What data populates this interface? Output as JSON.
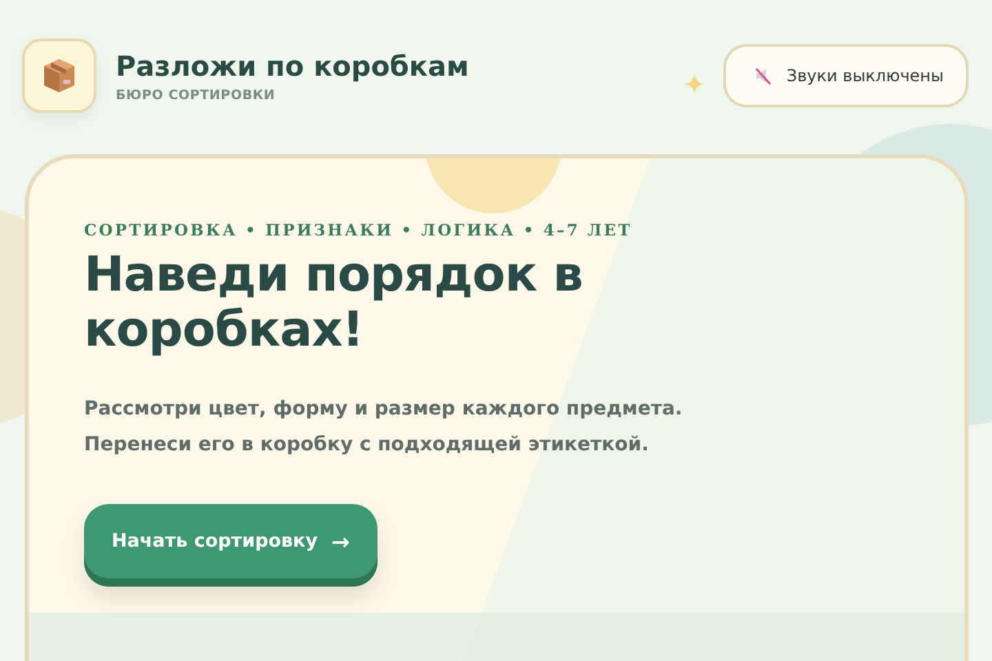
{
  "header": {
    "title": "Разложи по коробкам",
    "subtitle": "БЮРО СОРТИРОВКИ"
  },
  "sound": {
    "label": "Звуки выключены",
    "muted": true
  },
  "hero": {
    "eyebrow": "СОРТИРОВКА • ПРИЗНАКИ • ЛОГИКА • 4–7 ЛЕТ",
    "heading": "Наведи порядок в коробках!",
    "lines": [
      "Рассмотри цвет, форму и размер каждого предмета.",
      "Перенеси его в коробку с подходящей этикеткой."
    ],
    "button": {
      "label": "Начать сортировку",
      "arrow": "→"
    }
  }
}
